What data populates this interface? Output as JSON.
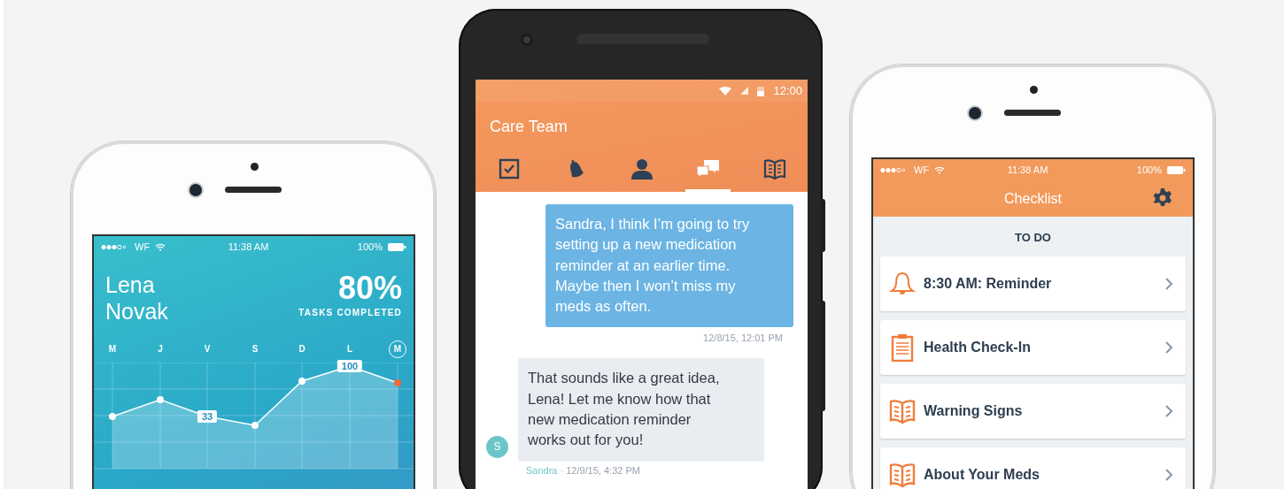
{
  "dashboard_phone": {
    "status": {
      "carrier": "WF",
      "time": "11:38 AM",
      "battery": "100%"
    },
    "name": "Lena Novak",
    "percent": "80%",
    "percent_caption": "TASKS COMPLETED",
    "days": [
      {
        "label": "M",
        "selected": false
      },
      {
        "label": "J",
        "selected": false
      },
      {
        "label": "V",
        "selected": false
      },
      {
        "label": "S",
        "selected": false
      },
      {
        "label": "D",
        "selected": false
      },
      {
        "label": "L",
        "selected": false
      },
      {
        "label": "M",
        "selected": true
      }
    ],
    "point_labels": [
      "33",
      "100"
    ]
  },
  "chat_phone": {
    "status": {
      "time": "12:00"
    },
    "title": "Care Team",
    "tabs": [
      {
        "kind": "checklist",
        "selected": false
      },
      {
        "kind": "bell",
        "selected": false
      },
      {
        "kind": "person",
        "selected": false
      },
      {
        "kind": "chat",
        "selected": true
      },
      {
        "kind": "book",
        "selected": false
      }
    ],
    "messages": [
      {
        "kind": "outgoing",
        "text": "Sandra, I think I’m going to try setting up a new medication reminder at an earlier time. Maybe then I won’t miss my meds as often.",
        "meta": "12/8/15, 12:01 PM"
      },
      {
        "kind": "incoming",
        "text": "That sounds like a great idea, Lena! Let me know how that new medication reminder works out for you!",
        "avatar": "S",
        "author": "Sandra",
        "separator": "·",
        "meta": "12/9/15, 4:32 PM"
      }
    ]
  },
  "checklist_phone": {
    "status": {
      "carrier": "WF",
      "time": "11:38 AM",
      "battery": "100%"
    },
    "title": "Checklist",
    "section": "TO DO",
    "items": [
      {
        "kind": "bell",
        "label": "8:30 AM: Reminder"
      },
      {
        "kind": "clipboard",
        "label": "Health Check-In"
      },
      {
        "kind": "book",
        "label": "Warning Signs"
      },
      {
        "kind": "book",
        "label": "About Your Meds"
      }
    ]
  }
}
